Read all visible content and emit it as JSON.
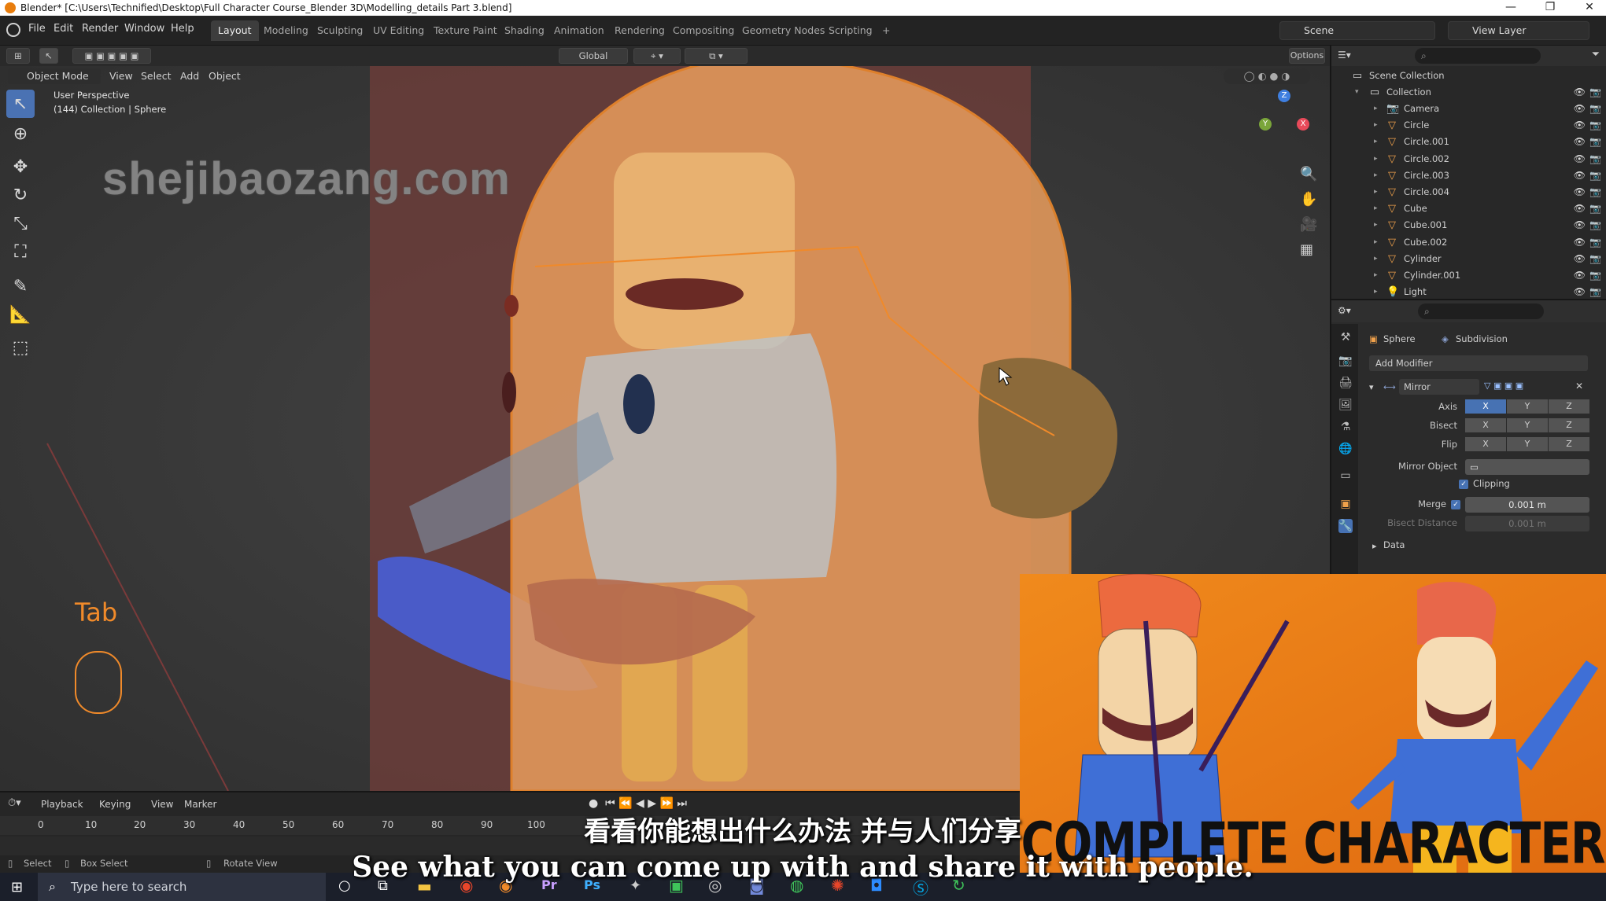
{
  "window": {
    "title": "Blender* [C:\\Users\\Technified\\Desktop\\Full Character Course_Blender 3D\\Modelling_details Part 3.blend]",
    "minimize": "—",
    "restore": "❐",
    "close": "✕"
  },
  "menubar": {
    "items": [
      "File",
      "Edit",
      "Render",
      "Window",
      "Help"
    ],
    "workspaces": [
      "Layout",
      "Modeling",
      "Sculpting",
      "UV Editing",
      "Texture Paint",
      "Shading",
      "Animation",
      "Rendering",
      "Compositing",
      "Geometry Nodes",
      "Scripting"
    ],
    "add_tab": "+",
    "scene": "Scene",
    "view_layer": "View Layer"
  },
  "toolheader": {
    "transform_orientation": "Global",
    "options": "Options"
  },
  "viewport": {
    "mode": "Object Mode",
    "menus": [
      "View",
      "Select",
      "Add",
      "Object"
    ],
    "perspective": "User Perspective",
    "collection_info": "(144) Collection | Sphere",
    "key_hint": "Tab",
    "watermark": "shejibaozang.com",
    "gizmo_axes": [
      "X",
      "Y",
      "Z"
    ]
  },
  "outliner": {
    "root": "Scene Collection",
    "collection": "Collection",
    "items": [
      {
        "name": "Camera",
        "icon": "camera-icon"
      },
      {
        "name": "Circle",
        "icon": "mesh-icon"
      },
      {
        "name": "Circle.001",
        "icon": "mesh-icon"
      },
      {
        "name": "Circle.002",
        "icon": "mesh-icon"
      },
      {
        "name": "Circle.003",
        "icon": "mesh-icon"
      },
      {
        "name": "Circle.004",
        "icon": "mesh-icon"
      },
      {
        "name": "Cube",
        "icon": "mesh-icon"
      },
      {
        "name": "Cube.001",
        "icon": "mesh-icon"
      },
      {
        "name": "Cube.002",
        "icon": "mesh-icon"
      },
      {
        "name": "Cylinder",
        "icon": "mesh-icon"
      },
      {
        "name": "Cylinder.001",
        "icon": "mesh-icon"
      },
      {
        "name": "Light",
        "icon": "light-icon"
      }
    ]
  },
  "properties": {
    "object": "Sphere",
    "modifier_tab": "Subdivision",
    "add_modifier": "Add Modifier",
    "modifier_name": "Mirror",
    "axis_label": "Axis",
    "bisect_label": "Bisect",
    "flip_label": "Flip",
    "axes": [
      "X",
      "Y",
      "Z"
    ],
    "mirror_object_label": "Mirror Object",
    "clipping_label": "Clipping",
    "merge_label": "Merge",
    "merge_value": "0.001 m",
    "bisect_distance_label": "Bisect Distance",
    "bisect_distance_value": "0.001 m",
    "data_label": "Data"
  },
  "timeline": {
    "menus": [
      "Playback",
      "Keying",
      "View",
      "Marker"
    ],
    "ticks": [
      "0",
      "10",
      "20",
      "30",
      "40",
      "50",
      "60",
      "70",
      "80",
      "90",
      "100"
    ]
  },
  "statusbar": {
    "select": "Select",
    "box_select": "Box Select",
    "rotate_view": "Rotate View"
  },
  "taskbar": {
    "search_placeholder": "Type here to search"
  },
  "promo": {
    "title": "COMPLETE CHARACTER COURSE"
  },
  "subtitles": {
    "chinese": "看看你能想出什么办法 并与人们分享",
    "english": "See what you can come up with and share it with people."
  },
  "colors": {
    "accent": "#4772b3",
    "selection_outline": "#f08a2a",
    "promo_bg": "#e8851a"
  }
}
